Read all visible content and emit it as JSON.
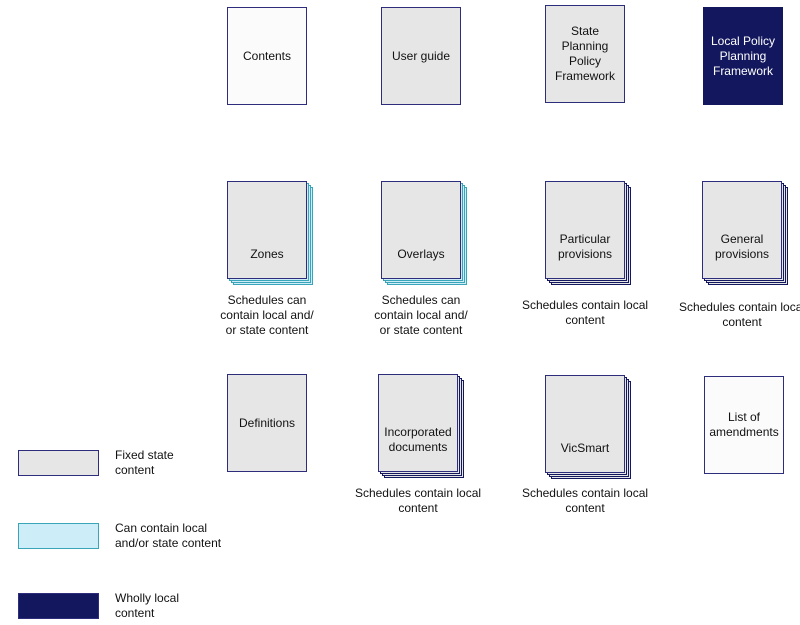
{
  "boxes": [
    {
      "label": "Contents",
      "style": "white",
      "stack": null
    },
    {
      "label": "User guide",
      "style": "grey",
      "stack": null
    },
    {
      "label": "State Planning Policy Framework",
      "style": "grey",
      "stack": null
    },
    {
      "label": "Local Policy Planning Framework",
      "style": "navy",
      "stack": null
    },
    {
      "label": "Zones",
      "style": "grey",
      "stack": "teal",
      "caption": "Schedules can contain local and/ or state content"
    },
    {
      "label": "Overlays",
      "style": "grey",
      "stack": "teal",
      "caption": "Schedules can contain local and/ or state content"
    },
    {
      "label": "Particular provisions",
      "style": "grey",
      "stack": "navy",
      "caption": "Schedules contain local content"
    },
    {
      "label": "General provisions",
      "style": "grey",
      "stack": "navy",
      "caption": "Schedules contain local content"
    },
    {
      "label": "Definitions",
      "style": "grey",
      "stack": null
    },
    {
      "label": "Incorporated documents",
      "style": "grey",
      "stack": "navy",
      "caption": "Schedules contain local content"
    },
    {
      "label": "VicSmart",
      "style": "grey",
      "stack": "navy",
      "caption": "Schedules contain local content"
    },
    {
      "label": "List of amendments",
      "style": "white",
      "stack": null
    }
  ],
  "legend": [
    {
      "label": "Fixed state content",
      "color": "#e6e6e6"
    },
    {
      "label": "Can contain local and/or state content",
      "color": "#cdeef8"
    },
    {
      "label": "Wholly local content",
      "color": "#12175e"
    }
  ]
}
